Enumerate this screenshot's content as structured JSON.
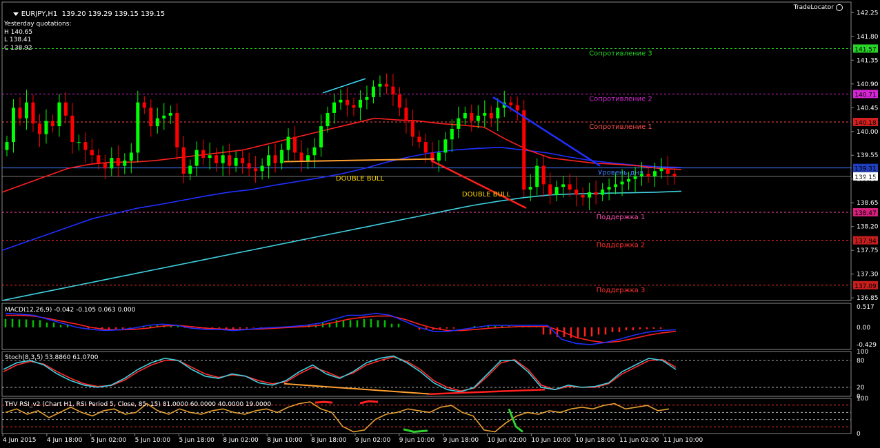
{
  "header": {
    "symbol_label": "EURJPY,H1",
    "ohlc": "139.20 139.29 139.15 139.15",
    "brand": "TradeLocator"
  },
  "yesterday": {
    "title": "Yesterday quotations:",
    "high": "H 140.65",
    "low": "L 138.41",
    "close": "C 138.92"
  },
  "chart_data": [
    {
      "type": "line",
      "panel": "price",
      "title": "EURJPY,H1",
      "y_ticks": [
        "142.25",
        "141.80",
        "141.35",
        "140.90",
        "140.45",
        "140.00",
        "139.55",
        "139.10",
        "138.65",
        "138.20",
        "137.75",
        "137.30",
        "136.85"
      ],
      "x_ticks": [
        "4 Jun 2015",
        "4 Jun 18:00",
        "5 Jun 02:00",
        "5 Jun 10:00",
        "5 Jun 18:00",
        "8 Jun 02:00",
        "8 Jun 10:00",
        "8 Jun 18:00",
        "9 Jun 02:00",
        "9 Jun 10:00",
        "9 Jun 18:00",
        "10 Jun 02:00",
        "10 Jun 10:00",
        "10 Jun 18:00",
        "11 Jun 02:00",
        "11 Jun 10:00"
      ],
      "ylim": [
        136.8,
        142.45
      ],
      "current_price": "139.15",
      "levels": [
        {
          "name": "Сопротивление 3",
          "value": 141.57,
          "tag": "141.57",
          "color": "#27d427",
          "tag_bg": "#27d427"
        },
        {
          "name": "Сопротивление 2",
          "value": 140.71,
          "tag": "140.71",
          "color": "#d427d4",
          "tag_bg": "#d427d4"
        },
        {
          "name": "Сопротивление 1",
          "value": 140.18,
          "tag": "140.18",
          "color": "#ff4d4d",
          "tag_bg": "#d42020"
        },
        {
          "name": "Уровень дня",
          "value": 139.31,
          "tag": "139.31",
          "color": "#3f7fff",
          "tag_bg": "#1f3fbf"
        },
        {
          "name": "Поддержка 1",
          "value": 138.47,
          "tag": "138.47",
          "color": "#ff4db0",
          "tag_bg": "#d4207a"
        },
        {
          "name": "Поддержка 2",
          "value": 137.94,
          "tag": "137.94",
          "color": "#ff3030",
          "tag_bg": "#c81e1e"
        },
        {
          "name": "Поддержка 3",
          "value": 137.09,
          "tag": "137.09",
          "color": "#ff3030",
          "tag_bg": "#c81e1e"
        }
      ],
      "annotations": [
        "DOUBLE BULL",
        "DOUBLE BULL"
      ],
      "series": [
        {
          "name": "EURJPY,H1",
          "color": "#00ff00",
          "values": [
            139.8,
            140.45,
            140.25,
            140.55,
            140.15,
            139.95,
            140.2,
            140.1,
            140.55,
            140.3,
            139.8,
            139.8,
            139.65,
            139.55,
            139.4,
            139.3,
            139.5,
            139.35,
            139.45,
            139.6,
            140.55,
            140.45,
            140.1,
            140.25,
            140.3,
            140.35,
            139.7,
            139.2,
            139.35,
            139.65,
            139.5,
            139.55,
            139.4,
            139.55,
            139.35,
            139.5,
            139.4,
            139.3,
            139.25,
            139.35,
            139.55,
            139.4,
            139.65,
            139.9,
            139.6,
            139.45,
            139.55,
            139.7,
            140.1,
            140.35,
            140.55,
            140.6,
            140.5,
            140.45,
            140.6,
            140.65,
            140.85,
            140.9,
            140.85,
            140.7,
            140.45,
            140.2,
            139.9,
            139.8,
            139.6,
            139.45,
            139.6,
            139.85,
            140.05,
            140.25,
            140.35,
            140.2,
            140.3,
            140.35,
            140.25,
            140.45,
            140.55,
            140.5,
            140.4,
            138.9,
            138.95,
            139.35,
            139.0,
            138.8,
            138.95,
            139.0,
            138.9,
            138.8,
            138.75,
            138.85,
            138.8,
            138.9,
            138.95,
            139.0,
            139.05,
            139.1,
            139.15,
            139.2,
            139.15,
            139.25,
            139.3,
            139.2,
            139.15
          ]
        },
        {
          "name": "",
          "color": "#ff2020",
          "values": [
            138.85,
            139.0,
            139.15,
            139.3,
            139.38,
            139.42,
            139.42,
            139.45,
            139.5,
            139.55,
            139.6,
            139.65,
            139.75,
            139.85,
            139.95,
            140.05,
            140.15,
            140.25,
            140.22,
            140.2,
            140.15,
            140.12,
            140.08,
            139.85,
            139.65,
            139.5,
            139.45,
            139.4,
            139.38,
            139.35,
            139.3,
            139.28
          ]
        },
        {
          "name": "",
          "color": "#2030ff",
          "values": [
            137.75,
            137.9,
            138.05,
            138.2,
            138.35,
            138.45,
            138.55,
            138.62,
            138.7,
            138.78,
            138.85,
            138.9,
            138.98,
            139.05,
            139.12,
            139.2,
            139.3,
            139.42,
            139.52,
            139.6,
            139.65,
            139.68,
            139.7,
            139.65,
            139.6,
            139.52,
            139.45,
            139.4,
            139.36,
            139.33,
            139.32
          ]
        },
        {
          "name": "",
          "color": "#40d0e0",
          "values": [
            136.8,
            136.9,
            137.0,
            137.1,
            137.2,
            137.3,
            137.4,
            137.5,
            137.6,
            137.7,
            137.8,
            137.9,
            138.0,
            138.1,
            138.2,
            138.3,
            138.4,
            138.5,
            138.6,
            138.68,
            138.75,
            138.8,
            138.82,
            138.83,
            138.84,
            138.85,
            138.87
          ]
        }
      ]
    },
    {
      "type": "line",
      "panel": "macd",
      "title": "MACD(12,26,9) -0.042 -0.105 0.063 0.000",
      "y_ticks": [
        "0.517",
        "0.00",
        "-0.429"
      ],
      "ylim": [
        -0.55,
        0.6
      ],
      "series": [
        {
          "name": "",
          "color": "#2030ff",
          "values": [
            0.35,
            0.33,
            0.3,
            0.2,
            0.1,
            0.0,
            -0.05,
            -0.08,
            -0.06,
            -0.02,
            0.05,
            0.08,
            0.05,
            -0.02,
            -0.05,
            -0.05,
            -0.08,
            -0.05,
            -0.02,
            0.0,
            0.02,
            0.05,
            0.1,
            0.2,
            0.3,
            0.3,
            0.35,
            0.3,
            0.15,
            0.0,
            -0.1,
            -0.1,
            -0.05,
            0.0,
            0.05,
            0.05,
            0.05,
            0.05,
            0.05,
            -0.3,
            -0.4,
            -0.43,
            -0.38,
            -0.3,
            -0.2,
            -0.12,
            -0.08,
            -0.06
          ]
        },
        {
          "name": "",
          "color": "#ff2020",
          "values": [
            0.3,
            0.3,
            0.28,
            0.22,
            0.15,
            0.08,
            0.0,
            -0.05,
            -0.06,
            -0.05,
            -0.02,
            0.03,
            0.05,
            0.02,
            -0.02,
            -0.04,
            -0.05,
            -0.05,
            -0.04,
            -0.02,
            0.0,
            0.02,
            0.05,
            0.12,
            0.2,
            0.25,
            0.28,
            0.28,
            0.2,
            0.08,
            -0.02,
            -0.08,
            -0.08,
            -0.05,
            -0.02,
            0.0,
            0.02,
            0.02,
            0.02,
            -0.1,
            -0.25,
            -0.33,
            -0.38,
            -0.35,
            -0.28,
            -0.2,
            -0.14,
            -0.1
          ]
        }
      ]
    },
    {
      "type": "line",
      "panel": "stoch",
      "title": "Stoch(8,3,5) 53.8860 61.0700",
      "y_ticks": [
        "100",
        "80",
        "20",
        "0"
      ],
      "ylim": [
        0,
        100
      ],
      "series": [
        {
          "name": "",
          "color": "#40d0e0",
          "values": [
            60,
            75,
            80,
            70,
            50,
            35,
            25,
            20,
            25,
            40,
            60,
            75,
            85,
            80,
            60,
            45,
            40,
            50,
            45,
            30,
            25,
            35,
            55,
            70,
            50,
            40,
            55,
            75,
            85,
            90,
            75,
            55,
            30,
            15,
            10,
            20,
            50,
            80,
            80,
            55,
            20,
            15,
            25,
            20,
            22,
            30,
            55,
            70,
            85,
            80,
            60
          ]
        },
        {
          "name": "",
          "color": "#ff3030",
          "values": [
            55,
            70,
            78,
            72,
            55,
            40,
            28,
            22,
            24,
            36,
            55,
            70,
            80,
            80,
            65,
            50,
            42,
            48,
            45,
            35,
            28,
            32,
            50,
            65,
            55,
            42,
            52,
            70,
            80,
            88,
            78,
            60,
            35,
            20,
            12,
            18,
            45,
            75,
            82,
            60,
            25,
            15,
            22,
            20,
            20,
            28,
            50,
            65,
            80,
            82,
            65
          ]
        }
      ]
    },
    {
      "type": "line",
      "panel": "rsi",
      "title": "THV RSI_v2 (Chart H1, RSI Period 5, Close, 85, 15) 81.0000 60.0000 40.0000 19.0000",
      "y_ticks": [
        "100",
        "0"
      ],
      "ylim": [
        0,
        100
      ],
      "series": [
        {
          "name": "",
          "color": "#e8a030",
          "values": [
            60,
            70,
            55,
            65,
            45,
            60,
            75,
            60,
            50,
            65,
            70,
            55,
            60,
            85,
            65,
            55,
            70,
            60,
            55,
            65,
            70,
            60,
            55,
            65,
            70,
            60,
            75,
            85,
            90,
            70,
            60,
            20,
            5,
            10,
            40,
            55,
            60,
            70,
            65,
            60,
            75,
            80,
            60,
            50,
            10,
            5,
            30,
            50,
            60,
            55,
            65,
            60,
            70,
            75,
            70,
            80,
            85,
            70,
            75,
            80,
            65,
            70
          ]
        }
      ]
    }
  ]
}
